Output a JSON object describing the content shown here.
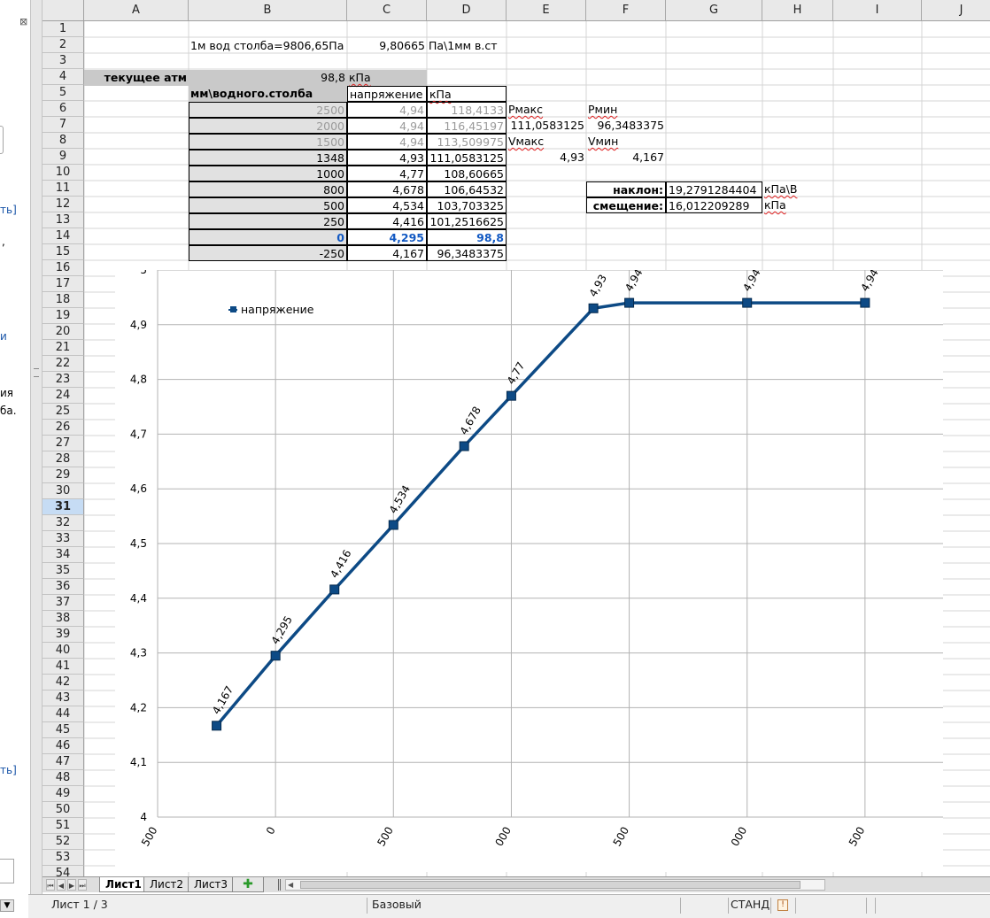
{
  "sidebar": {
    "fragments": [
      "⊠",
      "ть]",
      ",",
      "и",
      "ия",
      "ба.",
      "ть]"
    ]
  },
  "columns": [
    "A",
    "B",
    "C",
    "D",
    "E",
    "F",
    "G",
    "H",
    "I",
    "J"
  ],
  "rows": [
    "1",
    "2",
    "3",
    "4",
    "5",
    "6",
    "7",
    "8",
    "9",
    "10",
    "11",
    "12",
    "13",
    "14",
    "15",
    "16",
    "17",
    "18",
    "19",
    "20",
    "21",
    "22",
    "23",
    "24",
    "25",
    "26",
    "27",
    "28",
    "29",
    "30",
    "31",
    "32",
    "33",
    "34",
    "35",
    "36",
    "37",
    "38",
    "39",
    "40",
    "41",
    "42",
    "43",
    "44",
    "45",
    "46",
    "47",
    "48",
    "49",
    "50",
    "51",
    "52",
    "53",
    "54"
  ],
  "active_row": "31",
  "cells": {
    "b2": "1м вод столба=9806,65Па",
    "c2": "9,80665",
    "d2": "Па\\1мм в.ст",
    "a4": "текущее атм",
    "b4": "98,8",
    "c4": "кПа",
    "b5": "мм\\водного.столба",
    "c5": "напряжение",
    "d5": "кПа",
    "e6": "Pмакс",
    "f6": "Pмин",
    "e7": "111,0583125",
    "f7": "96,3483375",
    "e8": "Vмакс",
    "f8": "Vмин",
    "e9": "4,93",
    "f9": "4,167",
    "f11": "наклон:",
    "g11": "19,2791284404",
    "h11": "кПа\\В",
    "f12": "смещение:",
    "g12": "16,012209289",
    "h12": "кПа"
  },
  "table_rows": [
    {
      "b": "2500",
      "c": "4,94",
      "d": "118,4133"
    },
    {
      "b": "2000",
      "c": "4,94",
      "d": "116,45197"
    },
    {
      "b": "1500",
      "c": "4,94",
      "d": "113,509975"
    },
    {
      "b": "1348",
      "c": "4,93",
      "d": "111,0583125"
    },
    {
      "b": "1000",
      "c": "4,77",
      "d": "108,60665"
    },
    {
      "b": "800",
      "c": "4,678",
      "d": "106,64532"
    },
    {
      "b": "500",
      "c": "4,534",
      "d": "103,703325"
    },
    {
      "b": "250",
      "c": "4,416",
      "d": "101,2516625"
    },
    {
      "b": "0",
      "c": "4,295",
      "d": "98,8"
    },
    {
      "b": "-250",
      "c": "4,167",
      "d": "96,3483375"
    }
  ],
  "chart_data": {
    "type": "line",
    "title": "",
    "xlabel": "",
    "ylabel": "",
    "legend": "top-left",
    "grid": true,
    "ylim": [
      4,
      5
    ],
    "xlim": [
      -500,
      3000
    ],
    "y_ticks": [
      "4",
      "4,1",
      "4,2",
      "4,3",
      "4,4",
      "4,5",
      "4,6",
      "4,7",
      "4,8",
      "4,9",
      "5"
    ],
    "x_ticks": [
      "500",
      "0",
      "500",
      "000",
      "500",
      "000",
      "500",
      "000"
    ],
    "series": [
      {
        "name": "напряжение",
        "color": "#0d4a85",
        "x": [
          -250,
          0,
          250,
          500,
          800,
          1000,
          1348,
          1500,
          2000,
          2500
        ],
        "y": [
          4.167,
          4.295,
          4.416,
          4.534,
          4.678,
          4.77,
          4.93,
          4.94,
          4.94,
          4.94
        ],
        "labels": [
          "4,167",
          "4,295",
          "4,416",
          "4,534",
          "4,678",
          "4,77",
          "4,93",
          "4,94",
          "4,94",
          "4,94"
        ]
      }
    ]
  },
  "tabs": [
    "Лист1",
    "Лист2",
    "Лист3"
  ],
  "status": {
    "page": "Лист 1 / 3",
    "style": "Базовый",
    "mode": "СТАНД"
  }
}
